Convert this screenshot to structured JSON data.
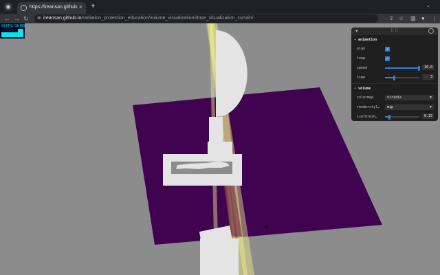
{
  "browser": {
    "tab_title": "https://ireansan.github.io/radi",
    "tab_close": "×",
    "new_tab": "+",
    "url_host": "ireansan.github.io",
    "url_path": "/radiation_protection_education/volume_visualization/dose_visualization_curtain/"
  },
  "stats": {
    "fps_text": "61 FPS (16-86)"
  },
  "gui": {
    "folders": {
      "animation": "animation",
      "volume": "volume"
    },
    "animation": {
      "play": {
        "label": "play",
        "checked": true
      },
      "loop": {
        "label": "loop",
        "checked": true
      },
      "speed": {
        "label": "speed",
        "value": "16.0",
        "fraction": 0.98
      },
      "time": {
        "label": "time",
        "value": "3",
        "fraction": 0.26
      }
    },
    "volume": {
      "colormap": {
        "label": "colormap",
        "value": "viridis"
      },
      "renderstyle": {
        "label": "renderstyl…",
        "value": "mip"
      },
      "isothreshold": {
        "label": "isothresh…",
        "value": "0.15",
        "fraction": 0.12
      }
    }
  },
  "colors": {
    "background": "#8c8c8c",
    "floor": "#3f0350",
    "curtain": "#f2f08a",
    "objects": "#e4e4e4",
    "accent": "#2f7fe6"
  }
}
